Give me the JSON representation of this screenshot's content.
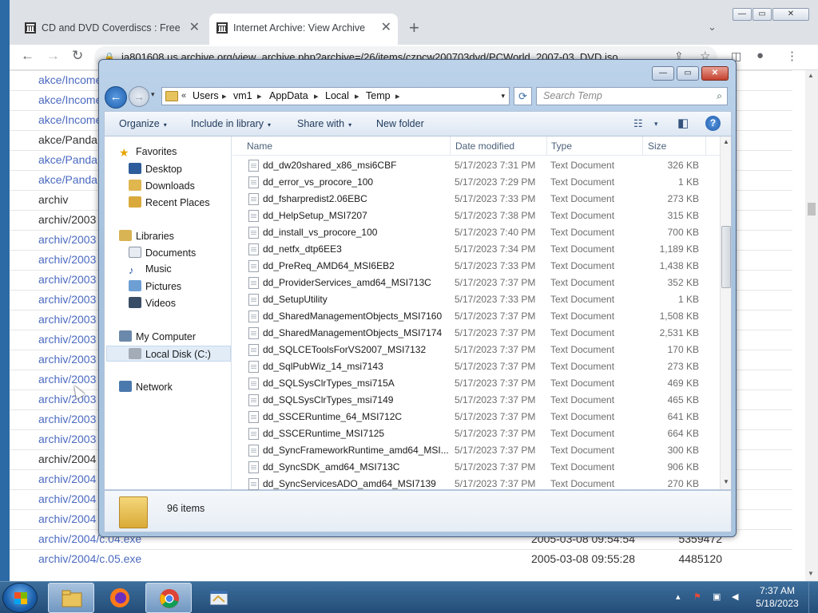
{
  "browser": {
    "tabs": [
      {
        "title": "CD and DVD Coverdiscs : Free So",
        "close": "✕"
      },
      {
        "title": "Internet Archive: View Archive",
        "close": "✕"
      }
    ],
    "new_tab": "+",
    "tab_menu": "⌄",
    "window_buttons": {
      "minimize": "—",
      "maximize": "▭",
      "close": "✕"
    },
    "nav": {
      "back": "←",
      "forward": "→",
      "reload": "↻"
    },
    "address": "ia801608.us.archive.org/view_archive.php?archive=/26/items/czpcw200703dvd/PCWorld_2007-03_DVD.iso",
    "page_rows": [
      {
        "name": "akce/Income",
        "link": true,
        "date": "",
        "size": ""
      },
      {
        "name": "akce/Income",
        "link": true,
        "date": "",
        "size": ""
      },
      {
        "name": "akce/Income",
        "link": true,
        "date": "",
        "size": ""
      },
      {
        "name": "akce/Panda",
        "link": false,
        "date": "",
        "size": ""
      },
      {
        "name": "akce/Panda",
        "link": true,
        "date": "",
        "size": ""
      },
      {
        "name": "akce/Panda",
        "link": true,
        "date": "",
        "size": ""
      },
      {
        "name": "archiv",
        "link": false,
        "date": "",
        "size": ""
      },
      {
        "name": "archiv/2003",
        "link": false,
        "date": "",
        "size": ""
      },
      {
        "name": "archiv/2003",
        "link": true,
        "date": "",
        "size": ""
      },
      {
        "name": "archiv/2003",
        "link": true,
        "date": "",
        "size": ""
      },
      {
        "name": "archiv/2003",
        "link": true,
        "date": "",
        "size": ""
      },
      {
        "name": "archiv/2003",
        "link": true,
        "date": "",
        "size": ""
      },
      {
        "name": "archiv/2003",
        "link": true,
        "date": "",
        "size": ""
      },
      {
        "name": "archiv/2003",
        "link": true,
        "date": "",
        "size": ""
      },
      {
        "name": "archiv/2003",
        "link": true,
        "date": "",
        "size": ""
      },
      {
        "name": "archiv/2003",
        "link": true,
        "date": "",
        "size": ""
      },
      {
        "name": "archiv/2003",
        "link": true,
        "date": "",
        "size": ""
      },
      {
        "name": "archiv/2003",
        "link": true,
        "date": "",
        "size": ""
      },
      {
        "name": "archiv/2003",
        "link": true,
        "date": "",
        "size": ""
      },
      {
        "name": "archiv/2004",
        "link": false,
        "date": "",
        "size": ""
      },
      {
        "name": "archiv/2004",
        "link": true,
        "date": "",
        "size": ""
      },
      {
        "name": "archiv/2004",
        "link": true,
        "date": "",
        "size": ""
      },
      {
        "name": "archiv/2004",
        "link": true,
        "date": "",
        "size": ""
      },
      {
        "name": "archiv/2004/c.04.exe",
        "link": true,
        "date": "2005-03-08 09:54:54",
        "size": "5359472"
      },
      {
        "name": "archiv/2004/c.05.exe",
        "link": true,
        "date": "2005-03-08 09:55:28",
        "size": "4485120"
      }
    ]
  },
  "explorer": {
    "caption_buttons": {
      "minimize": "—",
      "maximize": "▭",
      "close": "✕"
    },
    "nav": {
      "back": "←",
      "forward": "→",
      "dropdown": "▾"
    },
    "breadcrumbs": [
      "Users",
      "vm1",
      "AppData",
      "Local",
      "Temp"
    ],
    "crumb_sep": "▸",
    "crumb_lead": "«",
    "refresh": "⟳",
    "search_placeholder": "Search Temp",
    "search_icon": "⌕",
    "commands": [
      "Organize",
      "Include in library",
      "Share with",
      "New folder"
    ],
    "command_dropdown": "▾",
    "view_icons": {
      "views": "☷",
      "views_dd": "▾",
      "preview": "◧",
      "help": "?"
    },
    "nav_pane": {
      "favorites_header": "Favorites",
      "favorites": [
        "Desktop",
        "Downloads",
        "Recent Places"
      ],
      "libraries_header": "Libraries",
      "libraries": [
        "Documents",
        "Music",
        "Pictures",
        "Videos"
      ],
      "computer_header": "My Computer",
      "computer": [
        "Local Disk (C:)"
      ],
      "network_header": "Network"
    },
    "columns": [
      "Name",
      "Date modified",
      "Type",
      "Size"
    ],
    "files": [
      {
        "name": "dd_dw20shared_x86_msi6CBF",
        "date": "5/17/2023 7:31 PM",
        "type": "Text Document",
        "size": "326 KB"
      },
      {
        "name": "dd_error_vs_procore_100",
        "date": "5/17/2023 7:29 PM",
        "type": "Text Document",
        "size": "1 KB"
      },
      {
        "name": "dd_fsharpredist2.06EBC",
        "date": "5/17/2023 7:33 PM",
        "type": "Text Document",
        "size": "273 KB"
      },
      {
        "name": "dd_HelpSetup_MSI7207",
        "date": "5/17/2023 7:38 PM",
        "type": "Text Document",
        "size": "315 KB"
      },
      {
        "name": "dd_install_vs_procore_100",
        "date": "5/17/2023 7:40 PM",
        "type": "Text Document",
        "size": "700 KB"
      },
      {
        "name": "dd_netfx_dtp6EE3",
        "date": "5/17/2023 7:34 PM",
        "type": "Text Document",
        "size": "1,189 KB"
      },
      {
        "name": "dd_PreReq_AMD64_MSI6EB2",
        "date": "5/17/2023 7:33 PM",
        "type": "Text Document",
        "size": "1,438 KB"
      },
      {
        "name": "dd_ProviderServices_amd64_MSI713C",
        "date": "5/17/2023 7:37 PM",
        "type": "Text Document",
        "size": "352 KB"
      },
      {
        "name": "dd_SetupUtility",
        "date": "5/17/2023 7:33 PM",
        "type": "Text Document",
        "size": "1 KB"
      },
      {
        "name": "dd_SharedManagementObjects_MSI7160",
        "date": "5/17/2023 7:37 PM",
        "type": "Text Document",
        "size": "1,508 KB"
      },
      {
        "name": "dd_SharedManagementObjects_MSI7174",
        "date": "5/17/2023 7:37 PM",
        "type": "Text Document",
        "size": "2,531 KB"
      },
      {
        "name": "dd_SQLCEToolsForVS2007_MSI7132",
        "date": "5/17/2023 7:37 PM",
        "type": "Text Document",
        "size": "170 KB"
      },
      {
        "name": "dd_SqlPubWiz_14_msi7143",
        "date": "5/17/2023 7:37 PM",
        "type": "Text Document",
        "size": "273 KB"
      },
      {
        "name": "dd_SQLSysClrTypes_msi715A",
        "date": "5/17/2023 7:37 PM",
        "type": "Text Document",
        "size": "469 KB"
      },
      {
        "name": "dd_SQLSysClrTypes_msi7149",
        "date": "5/17/2023 7:37 PM",
        "type": "Text Document",
        "size": "465 KB"
      },
      {
        "name": "dd_SSCERuntime_64_MSI712C",
        "date": "5/17/2023 7:37 PM",
        "type": "Text Document",
        "size": "641 KB"
      },
      {
        "name": "dd_SSCERuntime_MSI7125",
        "date": "5/17/2023 7:37 PM",
        "type": "Text Document",
        "size": "664 KB"
      },
      {
        "name": "dd_SyncFrameworkRuntime_amd64_MSI...",
        "date": "5/17/2023 7:37 PM",
        "type": "Text Document",
        "size": "300 KB"
      },
      {
        "name": "dd_SyncSDK_amd64_MSI713C",
        "date": "5/17/2023 7:37 PM",
        "type": "Text Document",
        "size": "906 KB"
      },
      {
        "name": "dd_SyncServicesADO_amd64_MSI7139",
        "date": "5/17/2023 7:37 PM",
        "type": "Text Document",
        "size": "270 KB"
      }
    ],
    "item_count": "96 items"
  },
  "taskbar": {
    "clock_time": "7:37 AM",
    "clock_date": "5/18/2023",
    "tray_icons": [
      "▴",
      "⚑",
      "▣",
      "◀"
    ]
  },
  "colors": {
    "link": "#4b6ac0",
    "explorer_frame": "#a9c4df",
    "taskbar": "#2a5887"
  }
}
